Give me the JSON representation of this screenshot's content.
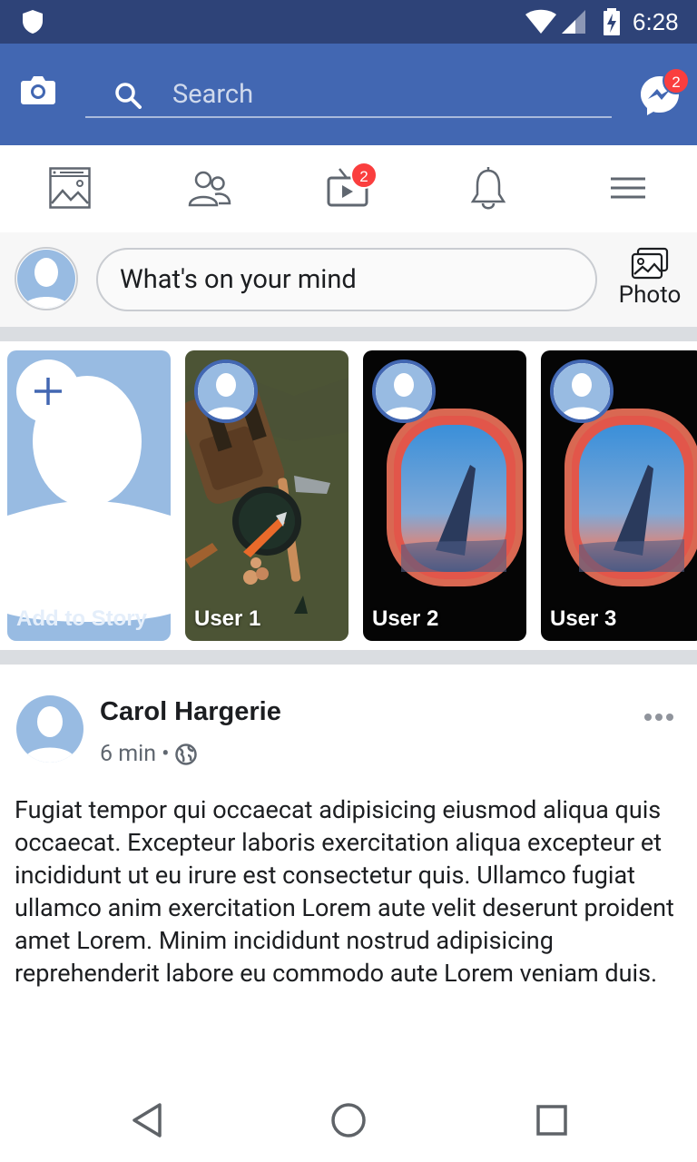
{
  "status_bar": {
    "time": "6:28"
  },
  "header": {
    "search_placeholder": "Search",
    "messenger_badge": "2"
  },
  "nav_tabs": {
    "watch_badge": "2"
  },
  "composer": {
    "prompt": "What's on your mind",
    "photo_label": "Photo"
  },
  "stories": [
    {
      "label": "Add to Story"
    },
    {
      "label": "User 1"
    },
    {
      "label": "User 2"
    },
    {
      "label": "User 3"
    }
  ],
  "post": {
    "author": "Carol Hargerie",
    "time": "6 min",
    "separator": "•",
    "body": "Fugiat tempor qui occaecat adipisicing eiusmod aliqua quis occaecat. Excepteur laboris exercitation aliqua excepteur et incididunt ut eu irure est consectetur quis. Ullamco fugiat ullamco anim exercitation Lorem aute velit deserunt proident amet Lorem. Minim incididunt nostrud adipisicing reprehenderit labore eu commodo aute Lorem veniam duis."
  },
  "colors": {
    "status_bar": "#2e4378",
    "header": "#4267b2",
    "badge": "#fa3e3e",
    "separator": "#dadde1",
    "avatar": "#98bbe2"
  }
}
